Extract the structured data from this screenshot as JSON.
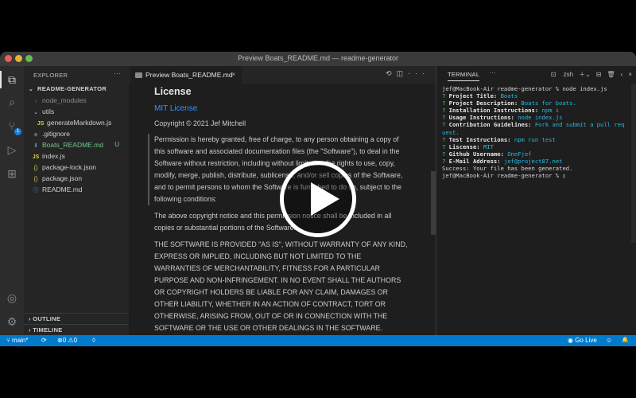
{
  "window": {
    "title": "Preview Boats_README.md — readme-generator"
  },
  "activity_bar": {
    "items": [
      {
        "name": "explorer",
        "icon": "files-icon",
        "glyph": "⧉"
      },
      {
        "name": "search",
        "icon": "search-icon",
        "glyph": "⌕"
      },
      {
        "name": "source-control",
        "icon": "source-control-icon",
        "glyph": "⑂",
        "badge": "1"
      },
      {
        "name": "run-debug",
        "icon": "run-debug-icon",
        "glyph": "▷"
      },
      {
        "name": "extensions",
        "icon": "extensions-icon",
        "glyph": "⊞"
      },
      {
        "name": "accounts",
        "icon": "account-icon",
        "glyph": "◎"
      },
      {
        "name": "manage",
        "icon": "gear-icon",
        "glyph": "⚙"
      }
    ]
  },
  "sidebar": {
    "header": "EXPLORER",
    "more": "···",
    "root": "README-GENERATOR",
    "tree": [
      {
        "label": "node_modules",
        "icon": "chevron-right",
        "glyph": "›",
        "type": "folder"
      },
      {
        "label": "utils",
        "icon": "chevron-down",
        "glyph": "⌄",
        "type": "folder"
      },
      {
        "label": "generateMarkdown.js",
        "icon": "js-icon",
        "glyph": "JS",
        "type": "js"
      },
      {
        "label": ".gitignore",
        "icon": "gitignore-icon",
        "glyph": "◆",
        "type": "git"
      },
      {
        "label": "Boats_README.md",
        "icon": "markdown-icon",
        "glyph": "⬇",
        "type": "md",
        "status": "U"
      },
      {
        "label": "index.js",
        "icon": "js-icon",
        "glyph": "JS",
        "type": "js"
      },
      {
        "label": "package-lock.json",
        "icon": "json-icon",
        "glyph": "{}",
        "type": "json"
      },
      {
        "label": "package.json",
        "icon": "json-icon",
        "glyph": "{}",
        "type": "json"
      },
      {
        "label": "README.md",
        "icon": "info-icon",
        "glyph": "ⓘ",
        "type": "info"
      }
    ],
    "sections": [
      "OUTLINE",
      "TIMELINE"
    ]
  },
  "editor": {
    "tab_label": "Preview Boats_README.md",
    "close_glyph": "×",
    "actions": [
      "⟲",
      "◫",
      "···"
    ],
    "preview": {
      "heading": "License",
      "link": "MIT License",
      "copyright": "Copyright © 2021 Jef Mitchell",
      "quote": "Permission is hereby granted, free of charge, to any person obtaining a copy of this software and associated documentation files (the \"Software\"), to deal in the Software without restriction, including without limitation the rights to use, copy, modify, merge, publish, distribute, sublicense, and/or sell copies of the Software, and to permit persons to whom the Software is furnished to do so, subject to the following conditions:",
      "para1": "The above copyright notice and this permission notice shall be included in all copies or substantial portions of the Software.",
      "para2": "THE SOFTWARE IS PROVIDED \"AS IS\", WITHOUT WARRANTY OF ANY KIND, EXPRESS OR IMPLIED, INCLUDING BUT NOT LIMITED TO THE WARRANTIES OF MERCHANTABILITY, FITNESS FOR A PARTICULAR PURPOSE AND NON-INFRINGEMENT. IN NO EVENT SHALL THE AUTHORS OR COPYRIGHT HOLDERS BE LIABLE FOR ANY CLAIM, DAMAGES OR OTHER LIABILITY, WHETHER IN AN ACTION OF CONTRACT, TORT OR OTHERWISE, ARISING FROM, OUT OF OR IN CONNECTION WITH THE SOFTWARE OR THE USE OR OTHER DEALINGS IN THE SOFTWARE."
    }
  },
  "panel": {
    "tab": "TERMINAL",
    "more": "···",
    "shell": "zsh",
    "tools": [
      "＋⌄",
      "⊟",
      "🗑",
      "‹",
      "×"
    ],
    "lines": [
      {
        "prompt": "jef@MacBook-Air readme-generator % node index.js"
      },
      {
        "q": "?",
        "key": "Project Title:",
        "val": "Boats"
      },
      {
        "q": "?",
        "key": "Project Description:",
        "val": "Boats for boats."
      },
      {
        "q": "?",
        "key": "Installation Instructions:",
        "val": "npm i"
      },
      {
        "q": "?",
        "key": "Usage Instructions:",
        "val": "node index.js"
      },
      {
        "q": "?",
        "key": "Contribution Guidelines:",
        "val": "Fork and submit a pull req\nuest."
      },
      {
        "q": "?",
        "key": "Test Instructions:",
        "val": "npm run test"
      },
      {
        "q": "?",
        "key": "Liscense:",
        "val": "MIT"
      },
      {
        "q": "?",
        "key": "Github Username:",
        "val": "OneFjef"
      },
      {
        "q": "?",
        "key": "E-Mail Address:",
        "val": "jef@project87.net"
      },
      {
        "prompt": "Success: Your file has been generated."
      },
      {
        "prompt": "jef@MacBook-Air readme-generator % ▯"
      }
    ]
  },
  "statusbar": {
    "branch": "main*",
    "sync": "⟳",
    "errors": "0",
    "warnings": "0",
    "live_share": "◊",
    "go_live": "Go Live",
    "feedback": "☺",
    "bell": "🔔"
  },
  "video": {
    "play_icon": "play-icon"
  }
}
